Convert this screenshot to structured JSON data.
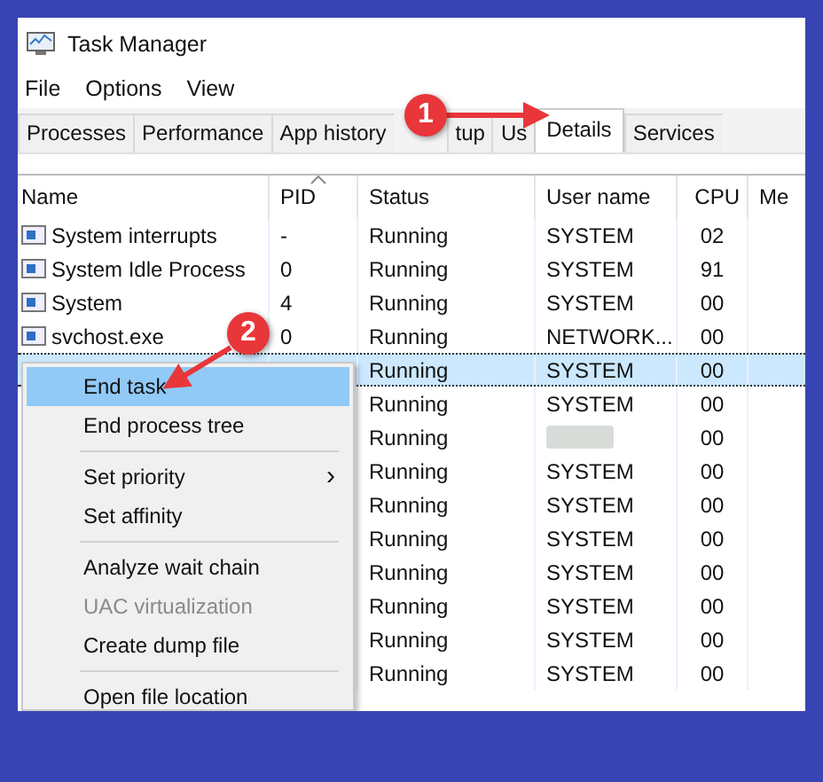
{
  "window": {
    "title": "Task Manager"
  },
  "menu_bar": [
    "File",
    "Options",
    "View"
  ],
  "tabs": [
    {
      "label": "Processes",
      "selected": false
    },
    {
      "label": "Performance",
      "selected": false
    },
    {
      "label": "App history",
      "selected": false
    },
    {
      "label": "tup",
      "selected": false
    },
    {
      "label": "Us",
      "selected": false
    },
    {
      "label": "Details",
      "selected": true
    },
    {
      "label": "Services",
      "selected": false
    }
  ],
  "table": {
    "columns": [
      "Name",
      "PID",
      "Status",
      "User name",
      "CPU",
      "Me"
    ],
    "rows": [
      {
        "name": "System interrupts",
        "pid": "-",
        "status": "Running",
        "user": "SYSTEM",
        "cpu": "02",
        "selected": false
      },
      {
        "name": "System Idle Process",
        "pid": "0",
        "status": "Running",
        "user": "SYSTEM",
        "cpu": "91",
        "selected": false
      },
      {
        "name": "System",
        "pid": "4",
        "status": "Running",
        "user": "SYSTEM",
        "cpu": "00",
        "selected": false
      },
      {
        "name": "svchost.exe",
        "pid": "0",
        "status": "Running",
        "user": "NETWORK...",
        "cpu": "00",
        "selected": false
      },
      {
        "status": "Running",
        "user": "SYSTEM",
        "cpu": "00",
        "selected": true
      },
      {
        "status": "Running",
        "user": "SYSTEM",
        "cpu": "00",
        "selected": false
      },
      {
        "status": "Running",
        "user_blurred": true,
        "cpu": "00",
        "selected": false
      },
      {
        "status": "Running",
        "user": "SYSTEM",
        "cpu": "00",
        "selected": false
      },
      {
        "status": "Running",
        "user": "SYSTEM",
        "cpu": "00",
        "selected": false
      },
      {
        "status": "Running",
        "user": "SYSTEM",
        "cpu": "00",
        "selected": false
      },
      {
        "status": "Running",
        "user": "SYSTEM",
        "cpu": "00",
        "selected": false
      },
      {
        "status": "Running",
        "user": "SYSTEM",
        "cpu": "00",
        "selected": false
      },
      {
        "status": "Running",
        "user": "SYSTEM",
        "cpu": "00",
        "selected": false
      },
      {
        "status": "Running",
        "user": "SYSTEM",
        "cpu": "00",
        "selected": false
      }
    ]
  },
  "context_menu": [
    {
      "kind": "item",
      "label": "End task",
      "selected": true,
      "disabled": false
    },
    {
      "kind": "item",
      "label": "End process tree",
      "selected": false,
      "disabled": false
    },
    {
      "kind": "separator"
    },
    {
      "kind": "submenu",
      "label": "Set priority",
      "arrow": "›",
      "selected": false,
      "disabled": false
    },
    {
      "kind": "item",
      "label": "Set affinity",
      "selected": false,
      "disabled": false
    },
    {
      "kind": "separator"
    },
    {
      "kind": "item",
      "label": "Analyze wait chain",
      "selected": false,
      "disabled": false
    },
    {
      "kind": "item",
      "label": "UAC virtualization",
      "selected": false,
      "disabled": true
    },
    {
      "kind": "item",
      "label": "Create dump file",
      "selected": false,
      "disabled": false
    },
    {
      "kind": "separator"
    },
    {
      "kind": "item",
      "label": "Open file location",
      "selected": false,
      "disabled": false
    }
  ],
  "annotations": [
    {
      "number": "1"
    },
    {
      "number": "2"
    }
  ]
}
